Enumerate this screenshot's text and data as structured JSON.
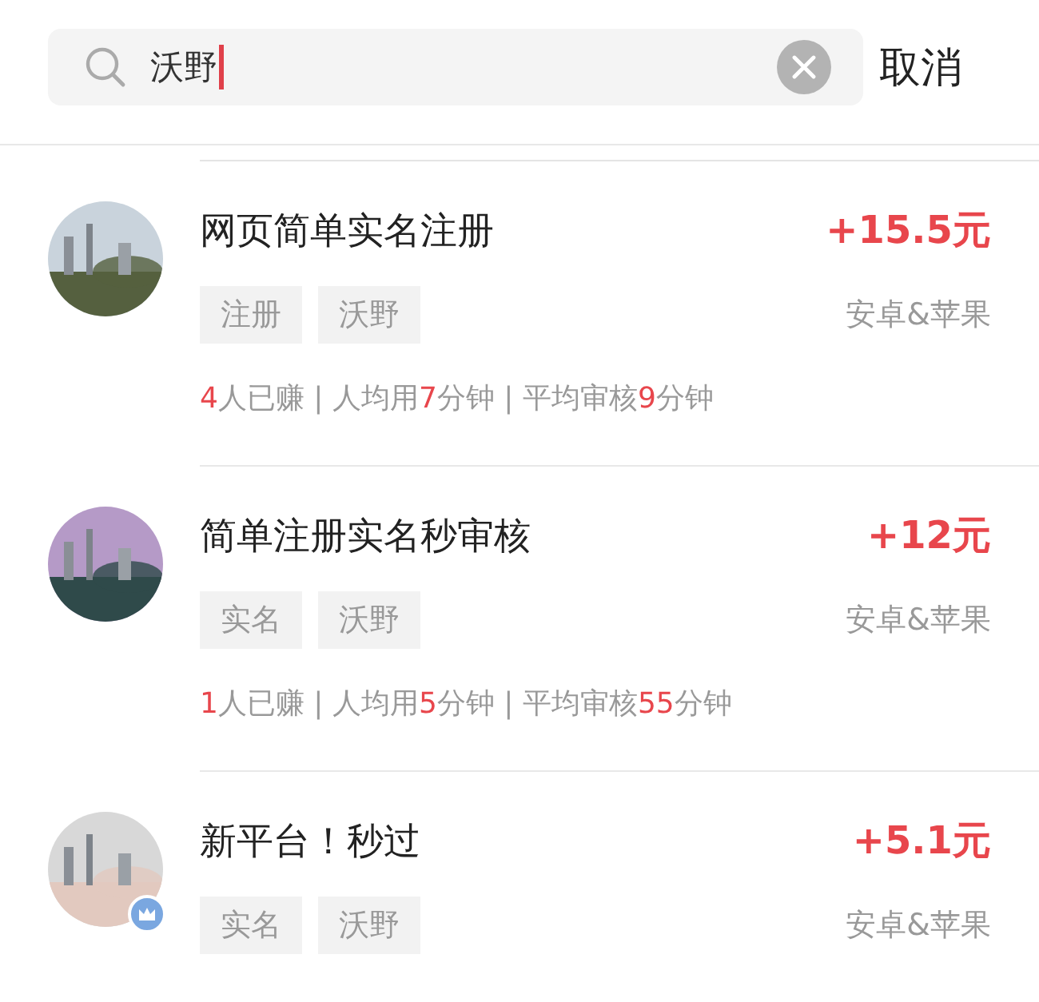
{
  "search": {
    "value": "沃野",
    "cancel": "取消"
  },
  "tasks": [
    {
      "title": "网页简单实名注册",
      "price": "+15.5元",
      "tags": [
        "注册",
        "沃野"
      ],
      "platform": "安卓&苹果",
      "badge": false,
      "stats": [
        {
          "text": "4",
          "highlight": true
        },
        {
          "text": "人已赚 | 人均用",
          "highlight": false
        },
        {
          "text": "7",
          "highlight": true
        },
        {
          "text": "分钟 | 平均审核",
          "highlight": false
        },
        {
          "text": "9",
          "highlight": true
        },
        {
          "text": "分钟",
          "highlight": false
        }
      ]
    },
    {
      "title": "简单注册实名秒审核",
      "price": "+12元",
      "tags": [
        "实名",
        "沃野"
      ],
      "platform": "安卓&苹果",
      "badge": false,
      "stats": [
        {
          "text": "1",
          "highlight": true
        },
        {
          "text": "人已赚 | 人均用",
          "highlight": false
        },
        {
          "text": "5",
          "highlight": true
        },
        {
          "text": "分钟 | 平均审核",
          "highlight": false
        },
        {
          "text": "55",
          "highlight": true
        },
        {
          "text": "分钟",
          "highlight": false
        }
      ]
    },
    {
      "title": "新平台！秒过",
      "price": "+5.1元",
      "tags": [
        "实名",
        "沃野"
      ],
      "platform": "安卓&苹果",
      "badge": true
    }
  ]
}
